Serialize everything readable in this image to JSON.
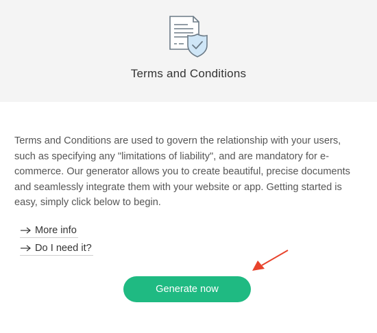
{
  "header": {
    "title": "Terms and Conditions",
    "icon": "terms-document-shield-icon"
  },
  "main": {
    "description": "Terms and Conditions are used to govern the relationship with your users, such as specifying any \"limitations of liability\", and are mandatory for e-commerce. Our generator allows you to create beautiful, precise documents and seamlessly integrate them with your website or app. Getting started is easy, simply click below to begin.",
    "links": [
      {
        "label": "More info",
        "icon": "arrow-right-icon"
      },
      {
        "label": "Do I need it?",
        "icon": "arrow-right-icon"
      }
    ],
    "generate_label": "Generate now"
  },
  "colors": {
    "header_bg": "#f4f4f4",
    "button_bg": "#1fba82",
    "annotation_arrow": "#e8432c",
    "icon_accent": "#cfe6f7"
  }
}
